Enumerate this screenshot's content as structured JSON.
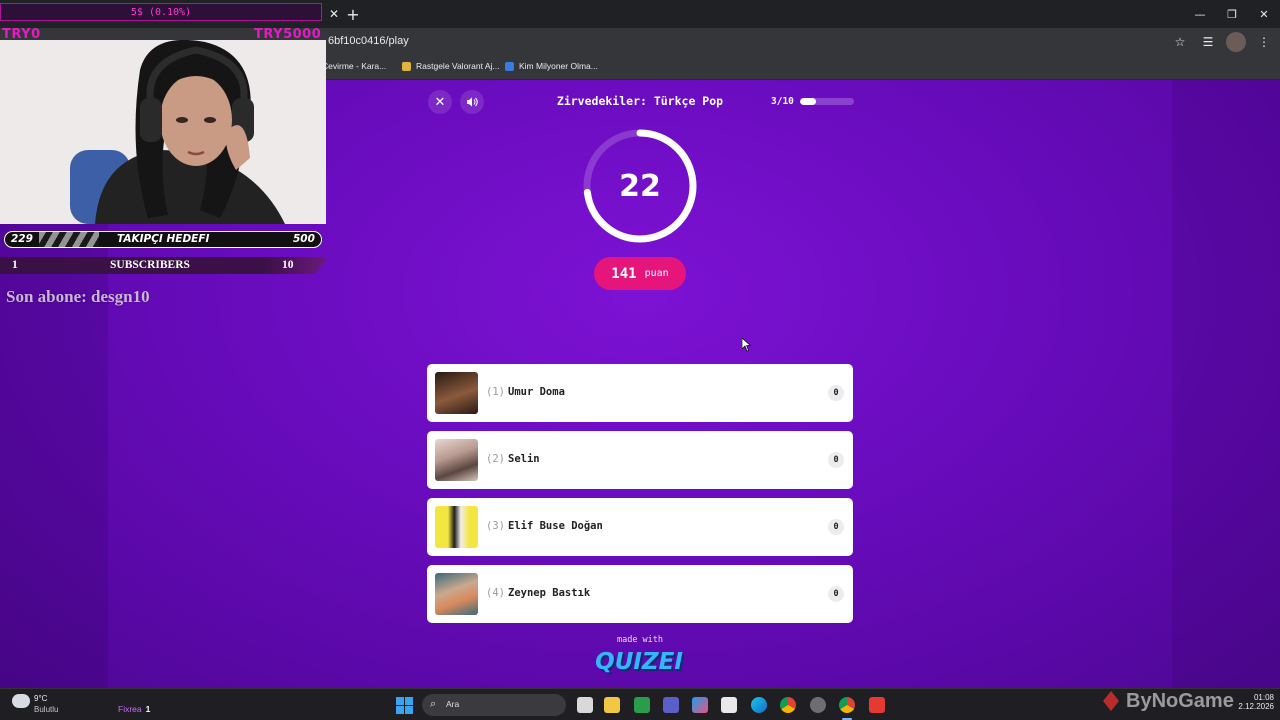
{
  "browser": {
    "url": "6bf10c0416/play",
    "bookmarks": [
      {
        "label": "Çevirme - Kara...",
        "color": "#e34a3a"
      },
      {
        "label": "Rastgele Valorant Aj...",
        "color": "#e0b43a"
      },
      {
        "label": "Kim Milyoner Olma...",
        "color": "#3a7be0"
      }
    ]
  },
  "quiz": {
    "title": "Zirvedekiler: Türkçe Pop",
    "progress_text": "3/10",
    "progress": 0.3,
    "timer": "22",
    "timer_fraction": 0.73,
    "score": "141",
    "score_unit": "puan",
    "options": [
      {
        "index": "(1)",
        "name": "Umur Doma",
        "count": "0",
        "thumb_colors": [
          "#2a1a14",
          "#8a5a3c"
        ]
      },
      {
        "index": "(2)",
        "name": "Selin",
        "count": "0",
        "thumb_colors": [
          "#e8d8d2",
          "#5b4640"
        ]
      },
      {
        "index": "(3)",
        "name": "Elif Buse Doğan",
        "count": "0",
        "thumb_colors": [
          "#f4e641",
          "#1d1d1d"
        ]
      },
      {
        "index": "(4)",
        "name": "Zeynep Bastık",
        "count": "0",
        "thumb_colors": [
          "#c9a88f",
          "#3a6a78"
        ]
      }
    ],
    "made_with": "made with",
    "brand": "QUIZEI",
    "colors": {
      "background": "#6a0cbf",
      "score_pill": "#e6157c",
      "timer_ring": "#ffffff"
    }
  },
  "overlay": {
    "donation": "5$ (0.10%)",
    "tag_left": "TRY0",
    "tag_right": "TRY5000",
    "follower_goal": {
      "current": "229",
      "label": "TAKIPÇI HEDEFI",
      "target": "500"
    },
    "subscribers": {
      "current": "1",
      "label": "SUBSCRIBERS",
      "target": "10"
    },
    "last_sub": "Son abone: desgn10"
  },
  "taskbar": {
    "weather_temp": "9°C",
    "weather_desc": "Bulutlu",
    "fixrea_label": "Fixrea",
    "fixrea_value": "1",
    "search_placeholder": "Ara",
    "clock_time": "01:08",
    "clock_date": "2.12.2026",
    "watermark": "ByNoGame"
  }
}
